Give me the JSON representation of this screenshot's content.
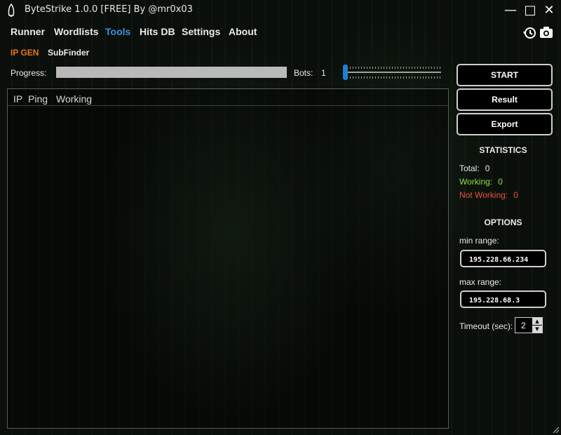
{
  "window": {
    "title": "ByteStrike 1.0.0 [FREE] By @mr0x03",
    "controls": {
      "minimize": "—",
      "maximize": "□",
      "close": "✕"
    }
  },
  "menu": {
    "items": [
      {
        "label": "Runner",
        "active": false
      },
      {
        "label": "Wordlists",
        "active": false
      },
      {
        "label": "Tools",
        "active": true
      },
      {
        "label": "Hits DB",
        "active": false
      },
      {
        "label": "Settings",
        "active": false
      },
      {
        "label": "About",
        "active": false
      }
    ],
    "icons": [
      "history-icon",
      "camera-icon"
    ]
  },
  "subtabs": [
    {
      "label": "IP GEN",
      "active": true
    },
    {
      "label": "SubFinder",
      "active": false
    }
  ],
  "progress": {
    "label": "Progress:",
    "value": 0
  },
  "bots": {
    "label": "Bots:",
    "value": "1",
    "slider_fraction": 0
  },
  "table": {
    "columns": [
      "IP",
      "Ping",
      "Working"
    ],
    "rows": []
  },
  "buttons": {
    "start": "START",
    "result": "Result",
    "export": "Export"
  },
  "statistics": {
    "heading": "STATISTICS",
    "total_label": "Total:",
    "total_value": "0",
    "working_label": "Working:",
    "working_value": "0",
    "not_working_label": "Not Working:",
    "not_working_value": "0"
  },
  "options": {
    "heading": "OPTIONS",
    "min_range_label": "min range:",
    "min_range_value": "195.228.66.234",
    "max_range_label": "max range:",
    "max_range_value": "195.228.68.3",
    "timeout_label": "Timeout (sec):",
    "timeout_value": "2"
  },
  "colors": {
    "accent_blue": "#3d8fe0",
    "accent_orange": "#e8761c",
    "working_green": "#8ee04a",
    "not_working_red": "#e8503a"
  }
}
